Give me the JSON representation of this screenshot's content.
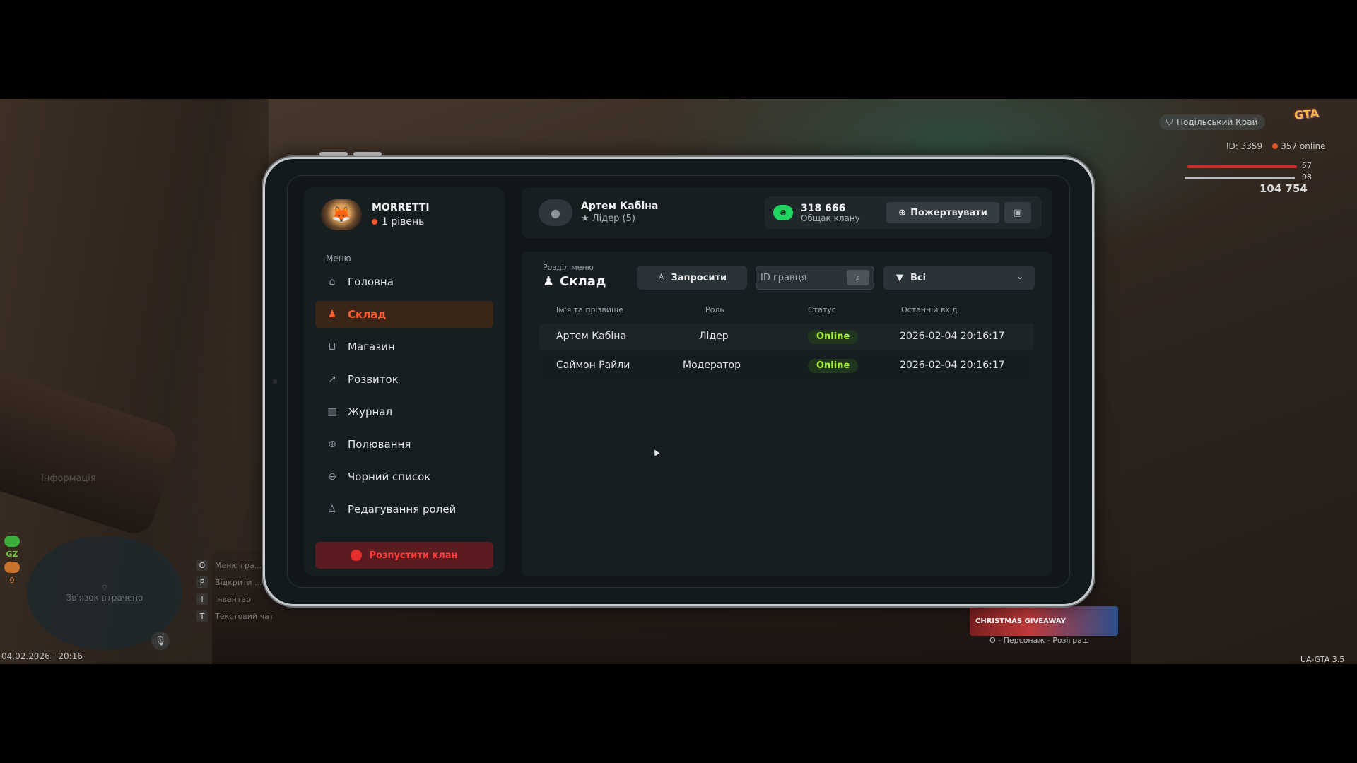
{
  "hud": {
    "server_name": "Подільський Край",
    "player_id": "ID: 3359",
    "online": "357 online",
    "health": "57",
    "armor": "98",
    "money": "104 754",
    "info_label": "Інформація",
    "gz_label": "GZ",
    "o_label": "0",
    "minimap_text": "Зв'язок втрачено",
    "keys": [
      {
        "key": "O",
        "label": "Меню гра..."
      },
      {
        "key": "P",
        "label": "Відкрити ..."
      },
      {
        "key": "I",
        "label": "Інвентар"
      },
      {
        "key": "T",
        "label": "Текстовий чат"
      }
    ],
    "datetime": "04.02.2026 | 20:16",
    "banner_text": "CHRISTMAS GIVEAWAY",
    "banner_sub": "O - Персонаж - Розіграш",
    "version": "UA-GTA 3.5",
    "logo_text": "GTA"
  },
  "profile": {
    "name": "MORRETTI",
    "level": "1 рівень"
  },
  "menu": {
    "title": "Меню",
    "items": [
      {
        "label": "Головна",
        "icon": "home-icon",
        "glyph": "⌂"
      },
      {
        "label": "Склад",
        "icon": "members-icon",
        "glyph": "♟"
      },
      {
        "label": "Магазин",
        "icon": "basket-icon",
        "glyph": "⊔"
      },
      {
        "label": "Розвиток",
        "icon": "chart-icon",
        "glyph": "↗"
      },
      {
        "label": "Журнал",
        "icon": "book-icon",
        "glyph": "▥"
      },
      {
        "label": "Полювання",
        "icon": "crosshair-icon",
        "glyph": "⊕"
      },
      {
        "label": "Чорний список",
        "icon": "block-icon",
        "glyph": "⊖"
      },
      {
        "label": "Редагування ролей",
        "icon": "user-edit-icon",
        "glyph": "♙"
      }
    ],
    "active_index": 1,
    "disband_label": "Розпустити клан"
  },
  "topbar": {
    "user_name": "Артем Кабіна",
    "user_role": "Лідер (5)",
    "bank_amount": "318 666",
    "bank_label": "Общак клану",
    "coin_symbol": "₴",
    "donate_label": "Пожертвувати"
  },
  "content": {
    "section_caption": "Розділ меню",
    "section_title": "Склад",
    "invite_label": "Запросити",
    "search_placeholder": "ID гравця",
    "filter_value": "Всі",
    "columns": {
      "name": "Ім'я та прізвище",
      "role": "Роль",
      "status": "Статус",
      "last_login": "Останній вхід"
    },
    "rows": [
      {
        "name": "Артем Кабіна",
        "role": "Лідер",
        "status": "Online",
        "last_login": "2026-02-04 20:16:17"
      },
      {
        "name": "Саймон Райли",
        "role": "Модератор",
        "status": "Online",
        "last_login": "2026-02-04 20:16:17"
      }
    ]
  },
  "colors": {
    "accent": "#ff5b2e",
    "online": "#a6f12c",
    "danger": "#ff3b3b",
    "coin": "#1ed760"
  }
}
